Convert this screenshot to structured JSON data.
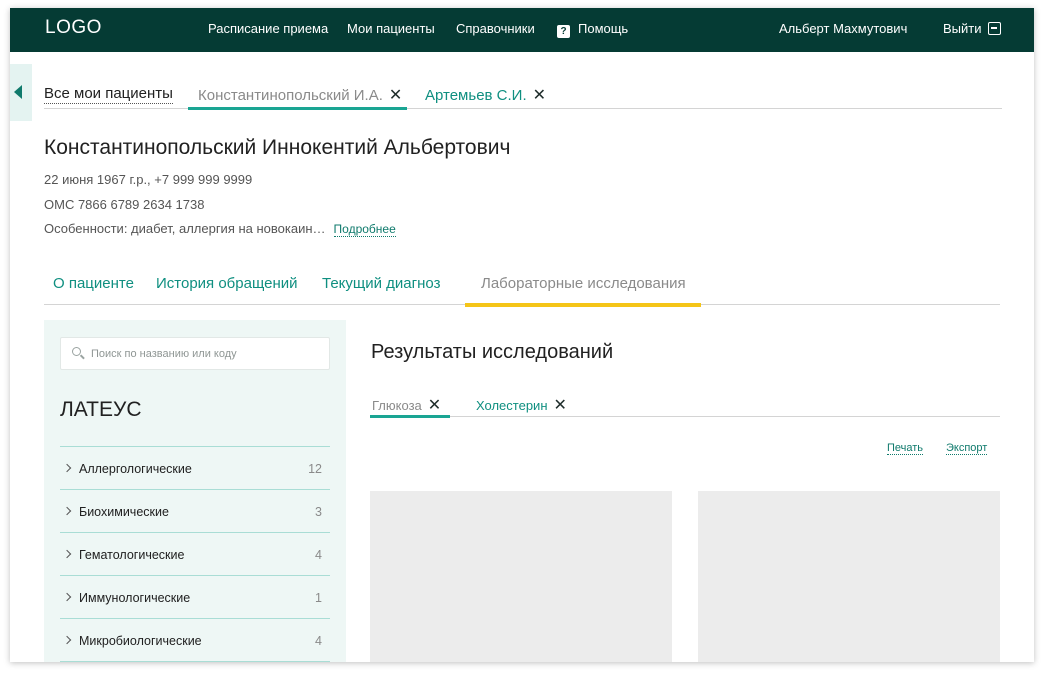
{
  "header": {
    "logo": "LOGO",
    "nav": [
      "Расписание приема",
      "Мои пациенты",
      "Справочники",
      "Помощь"
    ],
    "help_icon": "?",
    "user": "Альберт Махмутович",
    "logout": "Выйти"
  },
  "patient_tabs": {
    "all": "Все мои пациенты",
    "open": [
      "Константинопольский И.А.",
      "Артемьев С.И."
    ],
    "close_icon": "✕"
  },
  "patient": {
    "name": "Константинопольский Иннокентий Альбертович",
    "birth_phone": "22 июня 1967 г.р., +7 999 999 9999",
    "oms": "ОМС 7866 6789 2634 1738",
    "features": "Особенности: диабет, аллергия на новокаин…",
    "more": "Подробнее"
  },
  "section_tabs": [
    "О пациенте",
    "История обращений",
    "Текущий диагноз",
    "Лабораторные исследования"
  ],
  "lab_panel": {
    "search_placeholder": "Поиск по названию или коду",
    "title": "ЛАТЕУС",
    "categories": [
      {
        "label": "Аллергологические",
        "count": "12"
      },
      {
        "label": "Биохимические",
        "count": "3"
      },
      {
        "label": "Гематологические",
        "count": "4"
      },
      {
        "label": "Иммунологические",
        "count": "1"
      },
      {
        "label": "Микробиологические",
        "count": "4"
      }
    ]
  },
  "results": {
    "title": "Результаты исследований",
    "tabs": [
      "Глюкоза",
      "Холестерин"
    ],
    "print": "Печать",
    "export": "Экспорт"
  },
  "colors": {
    "header_bg": "#053b34",
    "accent": "#1aa593",
    "link": "#0f8f80",
    "active_tab": "#f5c518",
    "panel_bg": "#eef7f5"
  }
}
